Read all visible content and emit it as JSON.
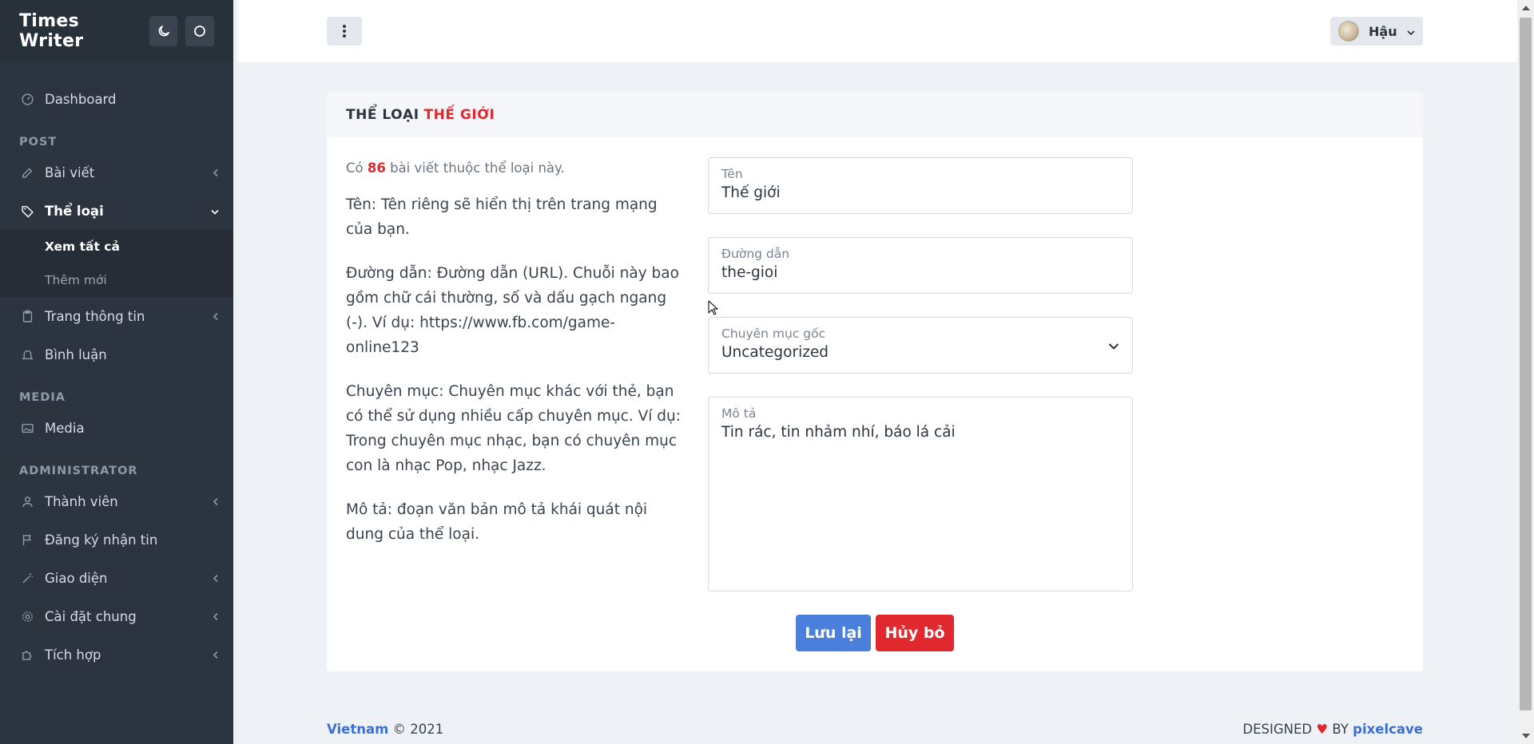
{
  "brand": {
    "title": "Times Writer",
    "theme_icon": "moon-icon",
    "circle_icon": "circle-icon"
  },
  "sidebar": {
    "dashboard": "Dashboard",
    "heading_post": "POST",
    "posts": "Bài viết",
    "categories": "Thể loại",
    "categories_sub": [
      "Xem tất cả",
      "Thêm mới"
    ],
    "pages": "Trang thông tin",
    "comments": "Bình luận",
    "heading_media": "MEDIA",
    "media": "Media",
    "heading_admin": "ADMINISTRATOR",
    "members": "Thành viên",
    "newsletter": "Đăng ký nhận tin",
    "appearance": "Giao diện",
    "settings": "Cài đặt chung",
    "integrations": "Tích hợp"
  },
  "header": {
    "user_name": "Hậu"
  },
  "card": {
    "title_prefix": "THỂ LOẠI",
    "title_accent": "THẾ GIỚI",
    "count_prefix": "Có",
    "count_value": "86",
    "count_suffix": "bài viết thuộc thể loại này.",
    "help_name": "Tên: Tên riêng sẽ hiển thị trên trang mạng của bạn.",
    "help_slug": "Đường dẫn: Đường dẫn (URL). Chuỗi này bao gồm chữ cái thường, số và dấu gạch ngang (-). Ví dụ: https://www.fb.com/game-online123",
    "help_parent": "Chuyên mục: Chuyên mục khác với thẻ, bạn có thể sử dụng nhiều cấp chuyên mục. Ví dụ: Trong chuyên mục nhạc, bạn có chuyên mục con là nhạc Pop, nhạc Jazz.",
    "help_desc": "Mô tả: đoạn văn bản mô tả khái quát nội dung của thể loại."
  },
  "form": {
    "name_label": "Tên",
    "name_value": "Thế giới",
    "slug_label": "Đường dẫn",
    "slug_value": "the-gioi",
    "parent_label": "Chuyên mục gốc",
    "parent_value": "Uncategorized",
    "desc_label": "Mô tả",
    "desc_value": "Tin rác, tin nhảm nhí, báo lá cải",
    "save": "Lưu lại",
    "cancel": "Hủy bỏ"
  },
  "footer": {
    "country": "Vietnam",
    "copyright": "© 2021",
    "designed": "DESIGNED",
    "by": "BY",
    "author": "pixelcave"
  },
  "colors": {
    "sidebar": "#2c3440",
    "accent_red": "#e0282e",
    "primary_blue": "#4a80dc"
  }
}
